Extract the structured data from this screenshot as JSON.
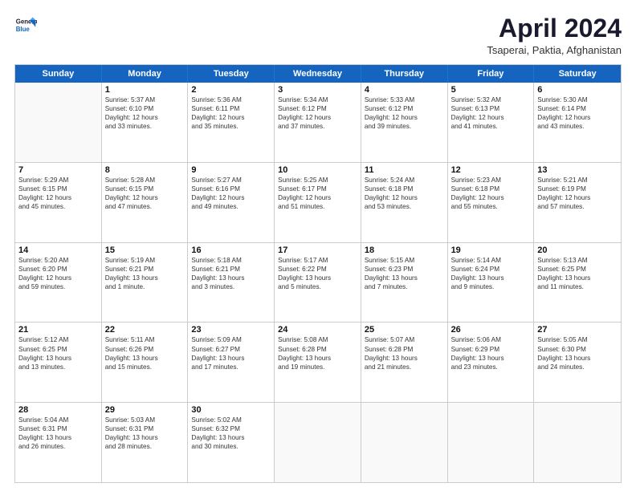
{
  "header": {
    "logo": {
      "line1": "General",
      "line2": "Blue"
    },
    "title": "April 2024",
    "location": "Tsaperai, Paktia, Afghanistan"
  },
  "weekdays": [
    "Sunday",
    "Monday",
    "Tuesday",
    "Wednesday",
    "Thursday",
    "Friday",
    "Saturday"
  ],
  "rows": [
    [
      {
        "day": "",
        "info": ""
      },
      {
        "day": "1",
        "info": "Sunrise: 5:37 AM\nSunset: 6:10 PM\nDaylight: 12 hours\nand 33 minutes."
      },
      {
        "day": "2",
        "info": "Sunrise: 5:36 AM\nSunset: 6:11 PM\nDaylight: 12 hours\nand 35 minutes."
      },
      {
        "day": "3",
        "info": "Sunrise: 5:34 AM\nSunset: 6:12 PM\nDaylight: 12 hours\nand 37 minutes."
      },
      {
        "day": "4",
        "info": "Sunrise: 5:33 AM\nSunset: 6:12 PM\nDaylight: 12 hours\nand 39 minutes."
      },
      {
        "day": "5",
        "info": "Sunrise: 5:32 AM\nSunset: 6:13 PM\nDaylight: 12 hours\nand 41 minutes."
      },
      {
        "day": "6",
        "info": "Sunrise: 5:30 AM\nSunset: 6:14 PM\nDaylight: 12 hours\nand 43 minutes."
      }
    ],
    [
      {
        "day": "7",
        "info": "Sunrise: 5:29 AM\nSunset: 6:15 PM\nDaylight: 12 hours\nand 45 minutes."
      },
      {
        "day": "8",
        "info": "Sunrise: 5:28 AM\nSunset: 6:15 PM\nDaylight: 12 hours\nand 47 minutes."
      },
      {
        "day": "9",
        "info": "Sunrise: 5:27 AM\nSunset: 6:16 PM\nDaylight: 12 hours\nand 49 minutes."
      },
      {
        "day": "10",
        "info": "Sunrise: 5:25 AM\nSunset: 6:17 PM\nDaylight: 12 hours\nand 51 minutes."
      },
      {
        "day": "11",
        "info": "Sunrise: 5:24 AM\nSunset: 6:18 PM\nDaylight: 12 hours\nand 53 minutes."
      },
      {
        "day": "12",
        "info": "Sunrise: 5:23 AM\nSunset: 6:18 PM\nDaylight: 12 hours\nand 55 minutes."
      },
      {
        "day": "13",
        "info": "Sunrise: 5:21 AM\nSunset: 6:19 PM\nDaylight: 12 hours\nand 57 minutes."
      }
    ],
    [
      {
        "day": "14",
        "info": "Sunrise: 5:20 AM\nSunset: 6:20 PM\nDaylight: 12 hours\nand 59 minutes."
      },
      {
        "day": "15",
        "info": "Sunrise: 5:19 AM\nSunset: 6:21 PM\nDaylight: 13 hours\nand 1 minute."
      },
      {
        "day": "16",
        "info": "Sunrise: 5:18 AM\nSunset: 6:21 PM\nDaylight: 13 hours\nand 3 minutes."
      },
      {
        "day": "17",
        "info": "Sunrise: 5:17 AM\nSunset: 6:22 PM\nDaylight: 13 hours\nand 5 minutes."
      },
      {
        "day": "18",
        "info": "Sunrise: 5:15 AM\nSunset: 6:23 PM\nDaylight: 13 hours\nand 7 minutes."
      },
      {
        "day": "19",
        "info": "Sunrise: 5:14 AM\nSunset: 6:24 PM\nDaylight: 13 hours\nand 9 minutes."
      },
      {
        "day": "20",
        "info": "Sunrise: 5:13 AM\nSunset: 6:25 PM\nDaylight: 13 hours\nand 11 minutes."
      }
    ],
    [
      {
        "day": "21",
        "info": "Sunrise: 5:12 AM\nSunset: 6:25 PM\nDaylight: 13 hours\nand 13 minutes."
      },
      {
        "day": "22",
        "info": "Sunrise: 5:11 AM\nSunset: 6:26 PM\nDaylight: 13 hours\nand 15 minutes."
      },
      {
        "day": "23",
        "info": "Sunrise: 5:09 AM\nSunset: 6:27 PM\nDaylight: 13 hours\nand 17 minutes."
      },
      {
        "day": "24",
        "info": "Sunrise: 5:08 AM\nSunset: 6:28 PM\nDaylight: 13 hours\nand 19 minutes."
      },
      {
        "day": "25",
        "info": "Sunrise: 5:07 AM\nSunset: 6:28 PM\nDaylight: 13 hours\nand 21 minutes."
      },
      {
        "day": "26",
        "info": "Sunrise: 5:06 AM\nSunset: 6:29 PM\nDaylight: 13 hours\nand 23 minutes."
      },
      {
        "day": "27",
        "info": "Sunrise: 5:05 AM\nSunset: 6:30 PM\nDaylight: 13 hours\nand 24 minutes."
      }
    ],
    [
      {
        "day": "28",
        "info": "Sunrise: 5:04 AM\nSunset: 6:31 PM\nDaylight: 13 hours\nand 26 minutes."
      },
      {
        "day": "29",
        "info": "Sunrise: 5:03 AM\nSunset: 6:31 PM\nDaylight: 13 hours\nand 28 minutes."
      },
      {
        "day": "30",
        "info": "Sunrise: 5:02 AM\nSunset: 6:32 PM\nDaylight: 13 hours\nand 30 minutes."
      },
      {
        "day": "",
        "info": ""
      },
      {
        "day": "",
        "info": ""
      },
      {
        "day": "",
        "info": ""
      },
      {
        "day": "",
        "info": ""
      }
    ]
  ]
}
